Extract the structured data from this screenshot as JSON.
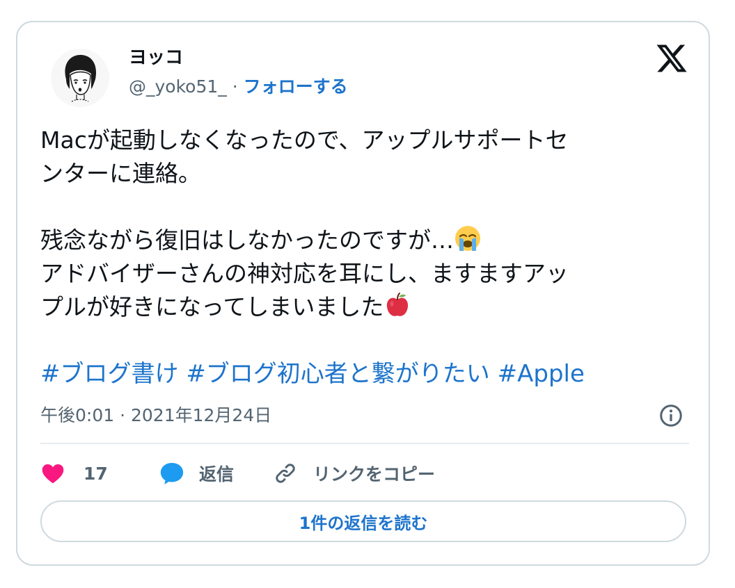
{
  "author": {
    "display_name": "ヨッコ",
    "handle": "@_yoko51_",
    "separator": "·",
    "follow_label": "フォローする"
  },
  "tweet": {
    "lines": [
      "Macが起動しなくなったので、アップルサポートセ",
      "ンターに連絡。",
      "",
      "残念ながら復旧はしなかったのですが…",
      "アドバイザーさんの神対応を耳にし、ますますアッ",
      "プルが好きになってしまいました"
    ],
    "emojis": [
      "loudly-crying-face",
      "red-apple"
    ],
    "hashtags": [
      "#ブログ書け",
      "#ブログ初心者と繋がりたい",
      "#Apple"
    ],
    "timestamp": "午後0:01 · 2021年12月24日"
  },
  "actions": {
    "like_count": "17",
    "reply_label": "返信",
    "copy_link_label": "リンクをコピー",
    "read_replies_label": "1件の返信を読む"
  },
  "icons": {
    "logo": "x-logo-icon",
    "info": "info-icon",
    "like": "heart-icon",
    "reply": "speech-bubble-icon",
    "copy_link": "link-icon"
  },
  "colors": {
    "link_blue": "#1d74cc",
    "like_pink": "#f91880",
    "reply_blue": "#1d9bf0",
    "secondary_text": "#536471",
    "border": "#cfd9de"
  }
}
